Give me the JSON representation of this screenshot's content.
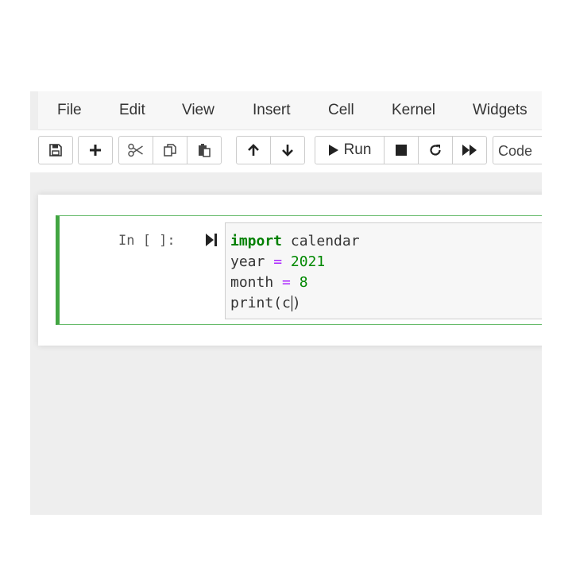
{
  "menu": {
    "items": [
      "File",
      "Edit",
      "View",
      "Insert",
      "Cell",
      "Kernel",
      "Widgets"
    ]
  },
  "toolbar": {
    "run_label": "Run",
    "cell_type": "Code",
    "icons": [
      "save-icon",
      "plus-icon",
      "scissors-icon",
      "copy-icon",
      "paste-icon",
      "arrow-up-icon",
      "arrow-down-icon",
      "play-icon",
      "stop-icon",
      "restart-icon",
      "fast-forward-icon"
    ]
  },
  "cell": {
    "prompt": "In [ ]:",
    "code": {
      "line1_kw": "import",
      "line1_rest": " calendar",
      "line2_var": "year ",
      "line2_op": "=",
      "line2_num": " 2021",
      "line3_var": "month ",
      "line3_op": "=",
      "line3_num": " 8",
      "line4": "print(c",
      "line4_close": ")"
    }
  },
  "colors": {
    "accent": "#42a542",
    "keyword": "#008000",
    "operator": "#aa22ff",
    "number": "#008800"
  }
}
